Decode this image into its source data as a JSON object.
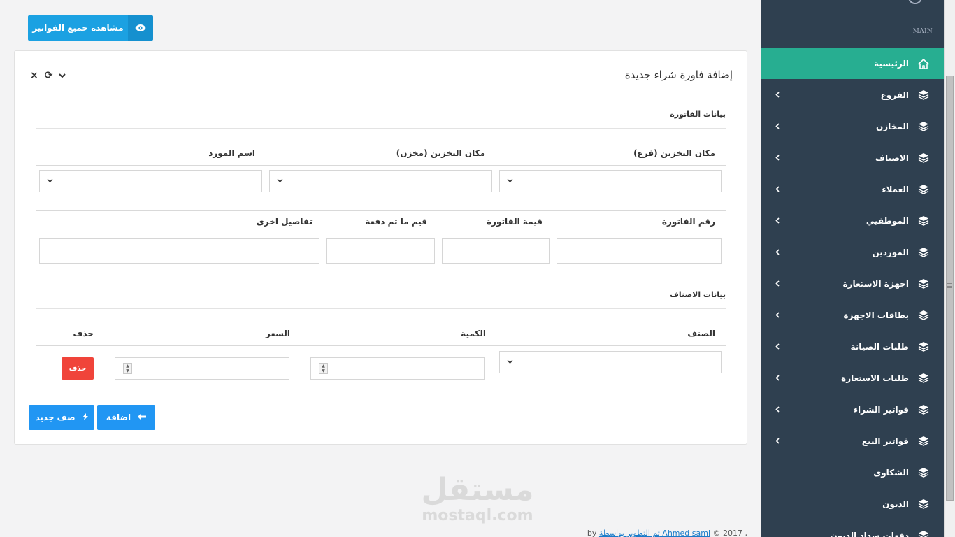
{
  "top_button": {
    "label": "مشاهدة جميع الفواتير",
    "icon": "eye-icon"
  },
  "card": {
    "title": "إضافة فاورة شراء جديدة",
    "tools": {
      "collapse": "⌄",
      "refresh": "⟳",
      "close": "×"
    },
    "invoice_section": "بيانات الفاتورة",
    "labels": {
      "branch": "مكان التخزين (فرع)",
      "store": "مكان التخزين (مخزن)",
      "supplier": "اسم المورد",
      "invoice_no": "رقم الفاتورة",
      "invoice_value": "قيمة الفاتورة",
      "paid": "قيم ما تم دفعة",
      "details": "تفاصيل اخرى"
    },
    "items_section": "بيانات الاصناف",
    "items_headers": {
      "item": "الصنف",
      "qty": "الكمية",
      "price": "السعر",
      "delete": "حذف"
    },
    "delete_button": "حذف",
    "add_button": "اضافة",
    "new_row_button": "صف جديد"
  },
  "sidebar": {
    "section": "MAIN",
    "items": [
      {
        "label": "الرئيسية",
        "active": true,
        "icon": "home-icon"
      },
      {
        "label": "الفروع",
        "icon": "layers-icon"
      },
      {
        "label": "المخازن",
        "icon": "layers-icon"
      },
      {
        "label": "الاصناف",
        "icon": "layers-icon"
      },
      {
        "label": "العملاء",
        "icon": "layers-icon"
      },
      {
        "label": "الموظفيي",
        "icon": "layers-icon"
      },
      {
        "label": "الموردين",
        "icon": "layers-icon"
      },
      {
        "label": "اجهزة الاستعارة",
        "icon": "layers-icon"
      },
      {
        "label": "بطاقات الاجهزة",
        "icon": "layers-icon"
      },
      {
        "label": "طلبات الصيانة",
        "icon": "layers-icon"
      },
      {
        "label": "طلبات الاستعارة",
        "icon": "layers-icon"
      },
      {
        "label": "فواتير الشراء",
        "icon": "layers-icon"
      },
      {
        "label": "فواتير البيع",
        "icon": "layers-icon"
      },
      {
        "label": "الشكاوى",
        "icon": "layers-icon"
      },
      {
        "label": "الديون",
        "icon": "layers-icon"
      },
      {
        "label": "دفعات سداد الديون",
        "icon": "layers-icon"
      }
    ]
  },
  "watermark": {
    "arabic": "مستقل",
    "latin": "mostaql.com"
  },
  "footer": {
    "prefix": "© 2017 ,",
    "credit": "تم التطوير بواسطة Ahmed sami",
    "by": "by"
  },
  "colors": {
    "sidebar": "#2f4050",
    "active": "#27ae91",
    "primary": "#2196f3",
    "danger": "#f0443a"
  }
}
